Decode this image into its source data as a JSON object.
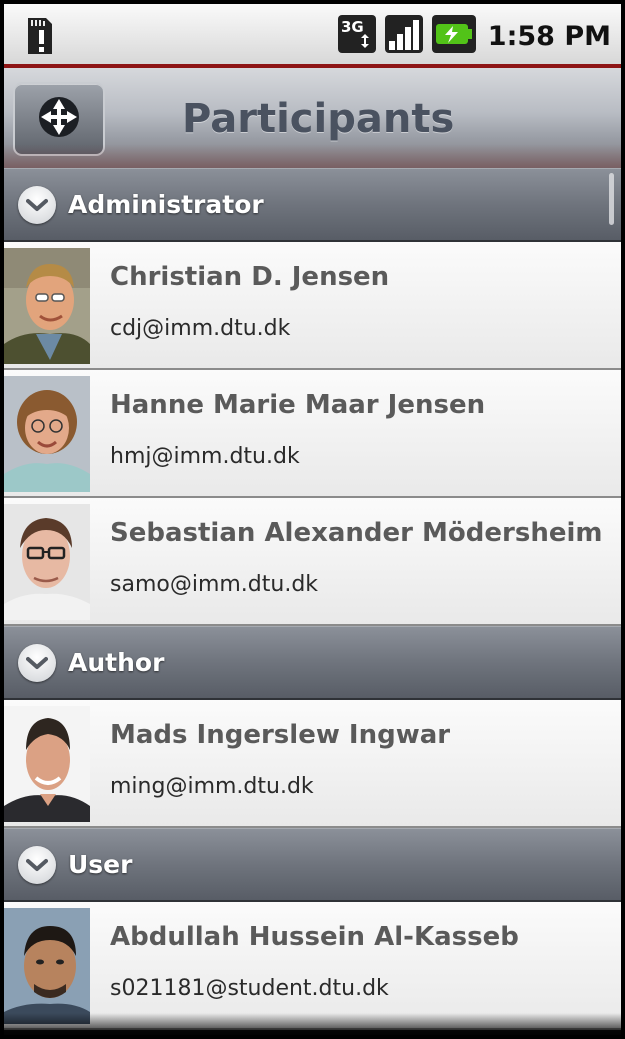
{
  "status_bar": {
    "network": "3G",
    "time": "1:58 PM",
    "icons": [
      "sd-card-alert-icon",
      "3g-data-icon",
      "signal-strength-icon",
      "battery-charging-icon"
    ]
  },
  "header": {
    "title": "Participants",
    "nav_icon": "move-arrows-icon"
  },
  "groups": [
    {
      "label": "Administrator",
      "members": [
        {
          "name": "Christian D. Jensen",
          "email": "cdj@imm.dtu.dk"
        },
        {
          "name": "Hanne Marie Maar Jensen",
          "email": "hmj@imm.dtu.dk"
        },
        {
          "name": "Sebastian Alexander Mödersheim",
          "email": "samo@imm.dtu.dk"
        }
      ]
    },
    {
      "label": "Author",
      "members": [
        {
          "name": "Mads Ingerslew Ingwar",
          "email": "ming@imm.dtu.dk"
        }
      ]
    },
    {
      "label": "User",
      "members": [
        {
          "name": "Abdullah Hussein Al-Kasseb",
          "email": "s021181@student.dtu.dk"
        }
      ]
    }
  ],
  "colors": {
    "status_bar_accent": "#8e1515",
    "title_text": "#4a5260",
    "group_header": "#6f747d",
    "name_text": "#5a5a5a"
  }
}
